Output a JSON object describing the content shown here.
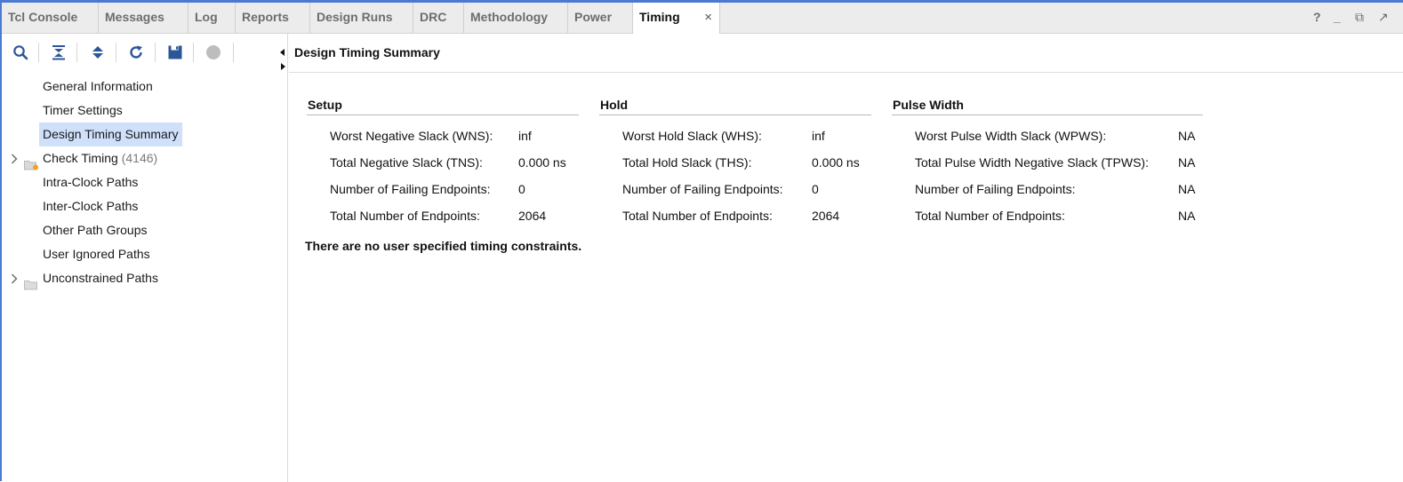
{
  "tabs": [
    {
      "label": "Tcl Console",
      "active": false
    },
    {
      "label": "Messages",
      "active": false
    },
    {
      "label": "Log",
      "active": false
    },
    {
      "label": "Reports",
      "active": false
    },
    {
      "label": "Design Runs",
      "active": false
    },
    {
      "label": "DRC",
      "active": false
    },
    {
      "label": "Methodology",
      "active": false
    },
    {
      "label": "Power",
      "active": false
    },
    {
      "label": "Timing",
      "active": true
    }
  ],
  "tab_close_glyph": "×",
  "window_controls": {
    "help": "?",
    "minimize": "_",
    "restore": "⧉",
    "float": "↗"
  },
  "toolbar": {
    "icons": [
      "search-icon",
      "collapse-all-icon",
      "expand-all-icon",
      "refresh-icon",
      "save-icon",
      "stop-icon"
    ]
  },
  "tree": {
    "items": [
      {
        "label": "General Information",
        "expandable": false,
        "selected": false
      },
      {
        "label": "Timer Settings",
        "expandable": false,
        "selected": false
      },
      {
        "label": "Design Timing Summary",
        "expandable": false,
        "selected": true
      },
      {
        "label": "Check Timing",
        "count": "(4146)",
        "expandable": true,
        "selected": false,
        "folder": "warning"
      },
      {
        "label": "Intra-Clock Paths",
        "expandable": false,
        "selected": false
      },
      {
        "label": "Inter-Clock Paths",
        "expandable": false,
        "selected": false
      },
      {
        "label": "Other Path Groups",
        "expandable": false,
        "selected": false
      },
      {
        "label": "User Ignored Paths",
        "expandable": false,
        "selected": false
      },
      {
        "label": "Unconstrained Paths",
        "expandable": true,
        "selected": false,
        "folder": "plain"
      }
    ]
  },
  "main": {
    "title": "Design Timing Summary",
    "sections": [
      {
        "title": "Setup",
        "rows": [
          {
            "label": "Worst Negative Slack (WNS):",
            "value": "inf"
          },
          {
            "label": "Total Negative Slack (TNS):",
            "value": "0.000 ns"
          },
          {
            "label": "Number of Failing Endpoints:",
            "value": "0"
          },
          {
            "label": "Total Number of Endpoints:",
            "value": "2064"
          }
        ]
      },
      {
        "title": "Hold",
        "rows": [
          {
            "label": "Worst Hold Slack (WHS):",
            "value": "inf"
          },
          {
            "label": "Total Hold Slack (THS):",
            "value": "0.000 ns"
          },
          {
            "label": "Number of Failing Endpoints:",
            "value": "0"
          },
          {
            "label": "Total Number of Endpoints:",
            "value": "2064"
          }
        ]
      },
      {
        "title": "Pulse Width",
        "rows": [
          {
            "label": "Worst Pulse Width Slack (WPWS):",
            "value": "NA"
          },
          {
            "label": "Total Pulse Width Negative Slack (TPWS):",
            "value": "NA"
          },
          {
            "label": "Number of Failing Endpoints:",
            "value": "NA"
          },
          {
            "label": "Total Number of Endpoints:",
            "value": "NA"
          }
        ]
      }
    ],
    "note": "There are no user specified timing constraints."
  },
  "colors": {
    "accent": "#4a7bd0",
    "selection": "#cfe0fb",
    "toolbar_icon": "#2b5797"
  }
}
